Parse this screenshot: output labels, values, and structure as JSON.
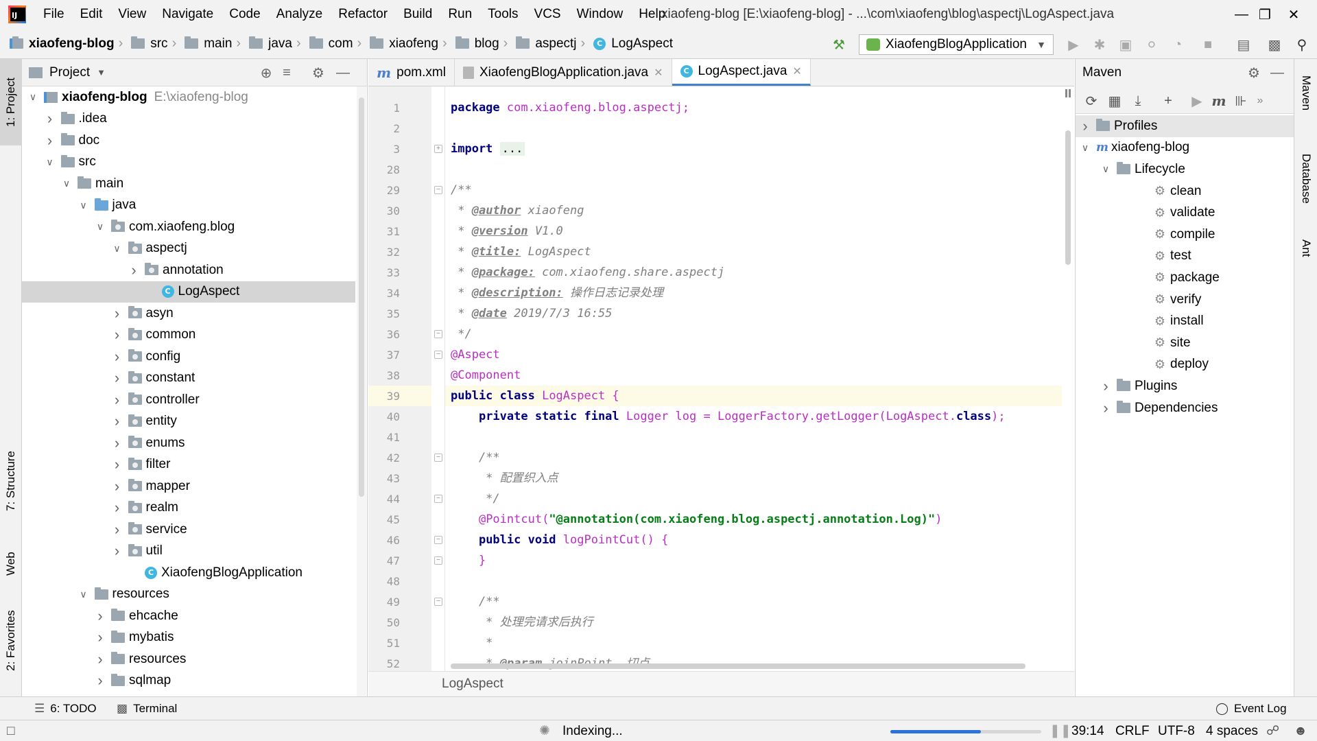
{
  "menu": {
    "items": [
      "File",
      "Edit",
      "View",
      "Navigate",
      "Code",
      "Analyze",
      "Refactor",
      "Build",
      "Run",
      "Tools",
      "VCS",
      "Window",
      "Help"
    ],
    "window_title": "xiaofeng-blog [E:\\xiaofeng-blog] - ...\\com\\xiaofeng\\blog\\aspectj\\LogAspect.java"
  },
  "breadcrumb": [
    "xiaofeng-blog",
    "src",
    "main",
    "java",
    "com",
    "xiaofeng",
    "blog",
    "aspectj",
    "LogAspect"
  ],
  "run_config": "XiaofengBlogApplication",
  "left_tabs": {
    "project": "1: Project",
    "structure": "7: Structure",
    "web": "Web",
    "favorites": "2: Favorites"
  },
  "right_tabs": {
    "maven": "Maven",
    "database": "Database",
    "ant": "Ant"
  },
  "project_panel": {
    "title": "Project",
    "tree": [
      {
        "label": "xiaofeng-blog",
        "path": "E:\\xiaofeng-blog",
        "indent": 0,
        "arrow": "down",
        "icon": "module",
        "bold": true
      },
      {
        "label": ".idea",
        "indent": 1,
        "arrow": "right",
        "icon": "folder"
      },
      {
        "label": "doc",
        "indent": 1,
        "arrow": "right",
        "icon": "folder"
      },
      {
        "label": "src",
        "indent": 1,
        "arrow": "down",
        "icon": "folder"
      },
      {
        "label": "main",
        "indent": 2,
        "arrow": "down",
        "icon": "folder"
      },
      {
        "label": "java",
        "indent": 3,
        "arrow": "down",
        "icon": "folder-blue"
      },
      {
        "label": "com.xiaofeng.blog",
        "indent": 4,
        "arrow": "down",
        "icon": "package"
      },
      {
        "label": "aspectj",
        "indent": 5,
        "arrow": "down",
        "icon": "package"
      },
      {
        "label": "annotation",
        "indent": 6,
        "arrow": "right",
        "icon": "package"
      },
      {
        "label": "LogAspect",
        "indent": 7,
        "arrow": "none",
        "icon": "class",
        "selected": true
      },
      {
        "label": "asyn",
        "indent": 5,
        "arrow": "right",
        "icon": "package"
      },
      {
        "label": "common",
        "indent": 5,
        "arrow": "right",
        "icon": "package"
      },
      {
        "label": "config",
        "indent": 5,
        "arrow": "right",
        "icon": "package"
      },
      {
        "label": "constant",
        "indent": 5,
        "arrow": "right",
        "icon": "package"
      },
      {
        "label": "controller",
        "indent": 5,
        "arrow": "right",
        "icon": "package"
      },
      {
        "label": "entity",
        "indent": 5,
        "arrow": "right",
        "icon": "package"
      },
      {
        "label": "enums",
        "indent": 5,
        "arrow": "right",
        "icon": "package"
      },
      {
        "label": "filter",
        "indent": 5,
        "arrow": "right",
        "icon": "package"
      },
      {
        "label": "mapper",
        "indent": 5,
        "arrow": "right",
        "icon": "package"
      },
      {
        "label": "realm",
        "indent": 5,
        "arrow": "right",
        "icon": "package"
      },
      {
        "label": "service",
        "indent": 5,
        "arrow": "right",
        "icon": "package"
      },
      {
        "label": "util",
        "indent": 5,
        "arrow": "right",
        "icon": "package"
      },
      {
        "label": "XiaofengBlogApplication",
        "indent": 6,
        "arrow": "none",
        "icon": "class"
      },
      {
        "label": "resources",
        "indent": 3,
        "arrow": "down",
        "icon": "folder"
      },
      {
        "label": "ehcache",
        "indent": 4,
        "arrow": "right",
        "icon": "folder"
      },
      {
        "label": "mybatis",
        "indent": 4,
        "arrow": "right",
        "icon": "folder"
      },
      {
        "label": "resources",
        "indent": 4,
        "arrow": "right",
        "icon": "folder"
      },
      {
        "label": "sqlmap",
        "indent": 4,
        "arrow": "right",
        "icon": "folder"
      }
    ]
  },
  "editor": {
    "tabs": [
      {
        "label": "pom.xml",
        "icon": "maven",
        "active": false
      },
      {
        "label": "XiaofengBlogApplication.java",
        "icon": "java-file",
        "active": false
      },
      {
        "label": "LogAspect.java",
        "icon": "class",
        "active": true
      }
    ],
    "lines": [
      {
        "n": "1",
        "fold": "",
        "tokens": [
          [
            "kw",
            "package"
          ],
          [
            "t",
            " "
          ],
          [
            "pkg",
            "com.xiaofeng.blog.aspectj;"
          ]
        ]
      },
      {
        "n": "2",
        "fold": "",
        "tokens": []
      },
      {
        "n": "3",
        "fold": "+",
        "tokens": [
          [
            "kw",
            "import"
          ],
          [
            "t",
            " "
          ],
          [
            "dots",
            "..."
          ]
        ]
      },
      {
        "n": "28",
        "fold": "",
        "tokens": []
      },
      {
        "n": "29",
        "fold": "-",
        "tokens": [
          [
            "cmt",
            "/**"
          ]
        ]
      },
      {
        "n": "30",
        "fold": "",
        "tokens": [
          [
            "cmt",
            " * "
          ],
          [
            "tag",
            "@author"
          ],
          [
            "cmt",
            " xiaofeng"
          ]
        ]
      },
      {
        "n": "31",
        "fold": "",
        "tokens": [
          [
            "cmt",
            " * "
          ],
          [
            "tag",
            "@version"
          ],
          [
            "cmt",
            " V1.0"
          ]
        ]
      },
      {
        "n": "32",
        "fold": "",
        "tokens": [
          [
            "cmt",
            " * "
          ],
          [
            "tag",
            "@title:"
          ],
          [
            "cmt",
            " LogAspect"
          ]
        ]
      },
      {
        "n": "33",
        "fold": "",
        "tokens": [
          [
            "cmt",
            " * "
          ],
          [
            "tag",
            "@package:"
          ],
          [
            "cmt",
            " com.xiaofeng.share.aspectj"
          ]
        ]
      },
      {
        "n": "34",
        "fold": "",
        "tokens": [
          [
            "cmt",
            " * "
          ],
          [
            "tag",
            "@description:"
          ],
          [
            "cmt",
            " 操作日志记录处理"
          ]
        ]
      },
      {
        "n": "35",
        "fold": "",
        "tokens": [
          [
            "cmt",
            " * "
          ],
          [
            "tag",
            "@date"
          ],
          [
            "cmt",
            " 2019/7/3 16:55"
          ]
        ]
      },
      {
        "n": "36",
        "fold": "-",
        "tokens": [
          [
            "cmt",
            " */"
          ]
        ]
      },
      {
        "n": "37",
        "fold": "-",
        "tokens": [
          [
            "ann",
            "@Aspect"
          ]
        ]
      },
      {
        "n": "38",
        "fold": "",
        "tokens": [
          [
            "ann",
            "@Component"
          ]
        ]
      },
      {
        "n": "39",
        "fold": "",
        "caret": true,
        "tokens": [
          [
            "kw",
            "public class"
          ],
          [
            "t",
            " "
          ],
          [
            "ann",
            "LogAspect {"
          ]
        ]
      },
      {
        "n": "40",
        "fold": "",
        "tokens": [
          [
            "t",
            "    "
          ],
          [
            "kw",
            "private static final"
          ],
          [
            "t",
            " "
          ],
          [
            "ann",
            "Logger log = LoggerFactory.getLogger(LogAspect."
          ],
          [
            "kw",
            "class"
          ],
          [
            "ann",
            ");"
          ]
        ]
      },
      {
        "n": "41",
        "fold": "",
        "tokens": []
      },
      {
        "n": "42",
        "fold": "-",
        "tokens": [
          [
            "t",
            "    "
          ],
          [
            "cmt",
            "/**"
          ]
        ]
      },
      {
        "n": "43",
        "fold": "",
        "tokens": [
          [
            "cmt",
            "     * 配置织入点"
          ]
        ]
      },
      {
        "n": "44",
        "fold": "-",
        "tokens": [
          [
            "cmt",
            "     */"
          ]
        ]
      },
      {
        "n": "45",
        "fold": "",
        "tokens": [
          [
            "t",
            "    "
          ],
          [
            "ann",
            "@Pointcut("
          ],
          [
            "str",
            "\"@annotation(com.xiaofeng.blog.aspectj.annotation.Log)\""
          ],
          [
            "ann",
            ")"
          ]
        ]
      },
      {
        "n": "46",
        "fold": "-",
        "tokens": [
          [
            "t",
            "    "
          ],
          [
            "kw",
            "public void"
          ],
          [
            "t",
            " "
          ],
          [
            "ann",
            "logPointCut() {"
          ]
        ]
      },
      {
        "n": "47",
        "fold": "-",
        "tokens": [
          [
            "t",
            "    "
          ],
          [
            "ann",
            "}"
          ]
        ]
      },
      {
        "n": "48",
        "fold": "",
        "tokens": []
      },
      {
        "n": "49",
        "fold": "-",
        "tokens": [
          [
            "t",
            "    "
          ],
          [
            "cmt",
            "/**"
          ]
        ]
      },
      {
        "n": "50",
        "fold": "",
        "tokens": [
          [
            "cmt",
            "     * 处理完请求后执行"
          ]
        ]
      },
      {
        "n": "51",
        "fold": "",
        "tokens": [
          [
            "cmt",
            "     *"
          ]
        ]
      },
      {
        "n": "52",
        "fold": "",
        "tokens": [
          [
            "cmt",
            "     * "
          ],
          [
            "tag",
            "@param"
          ],
          [
            "cmt",
            " joinPoint  切点"
          ]
        ]
      }
    ],
    "breadcrumb": "LogAspect"
  },
  "maven": {
    "title": "Maven",
    "tree": [
      {
        "label": "Profiles",
        "indent": 0,
        "arrow": "right",
        "icon": "profiles",
        "selected": true
      },
      {
        "label": "xiaofeng-blog",
        "indent": 0,
        "arrow": "down",
        "icon": "maven-module"
      },
      {
        "label": "Lifecycle",
        "indent": 1,
        "arrow": "down",
        "icon": "lifecycle"
      },
      {
        "label": "clean",
        "indent": 2,
        "arrow": "none",
        "icon": "gear"
      },
      {
        "label": "validate",
        "indent": 2,
        "arrow": "none",
        "icon": "gear"
      },
      {
        "label": "compile",
        "indent": 2,
        "arrow": "none",
        "icon": "gear"
      },
      {
        "label": "test",
        "indent": 2,
        "arrow": "none",
        "icon": "gear"
      },
      {
        "label": "package",
        "indent": 2,
        "arrow": "none",
        "icon": "gear"
      },
      {
        "label": "verify",
        "indent": 2,
        "arrow": "none",
        "icon": "gear"
      },
      {
        "label": "install",
        "indent": 2,
        "arrow": "none",
        "icon": "gear"
      },
      {
        "label": "site",
        "indent": 2,
        "arrow": "none",
        "icon": "gear"
      },
      {
        "label": "deploy",
        "indent": 2,
        "arrow": "none",
        "icon": "gear"
      },
      {
        "label": "Plugins",
        "indent": 1,
        "arrow": "right",
        "icon": "lifecycle"
      },
      {
        "label": "Dependencies",
        "indent": 1,
        "arrow": "right",
        "icon": "deps"
      }
    ]
  },
  "bottom": {
    "todo": "6: TODO",
    "terminal": "Terminal",
    "event_log": "Event Log"
  },
  "status": {
    "indexing": "Indexing...",
    "progress": 0.6,
    "position": "39:14",
    "line_sep": "CRLF",
    "encoding": "UTF-8",
    "indent": "4 spaces"
  },
  "colors": {
    "accent": "#4083c9",
    "progress": "#2a73d9",
    "selection": "#d5d5d5",
    "caret_line": "#fdfae6"
  }
}
